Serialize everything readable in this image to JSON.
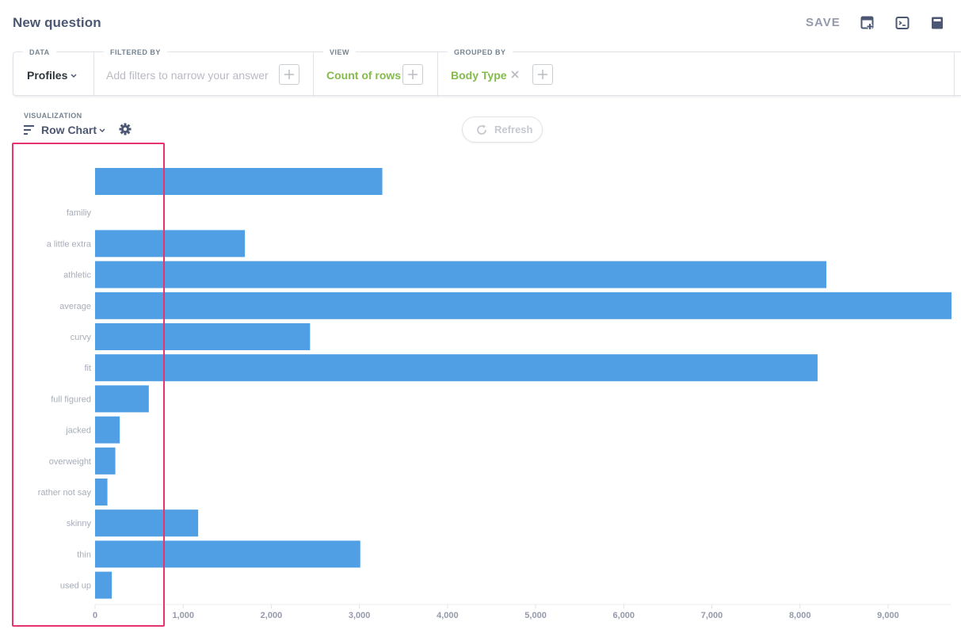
{
  "header": {
    "title": "New question",
    "save_label": "SAVE",
    "icons": [
      "add-to-dashboard-icon",
      "sql-editor-icon",
      "notebook-icon"
    ]
  },
  "query": {
    "data": {
      "label": "DATA",
      "value": "Profiles"
    },
    "filtered_by": {
      "label": "FILTERED BY",
      "placeholder": "Add filters to narrow your answer"
    },
    "view": {
      "label": "VIEW",
      "value": "Count of rows"
    },
    "grouped_by": {
      "label": "GROUPED BY",
      "value": "Body Type"
    }
  },
  "visualization": {
    "label": "VISUALIZATION",
    "type_label": "Row Chart",
    "refresh_label": "Refresh"
  },
  "colors": {
    "bar": "#509ee3",
    "accent_green": "#84bb4c",
    "highlight": "#e8336e"
  },
  "chart_data": {
    "type": "bar",
    "orientation": "horizontal",
    "categories": [
      "",
      "familiy",
      "a little extra",
      "athletic",
      "average",
      "curvy",
      "fit",
      "full figured",
      "jacked",
      "overweight",
      "rather not say",
      "skinny",
      "thin",
      "used up"
    ],
    "values": [
      3260,
      0,
      1700,
      8300,
      9720,
      2440,
      8200,
      610,
      280,
      230,
      140,
      1170,
      3010,
      190
    ],
    "x_ticks": [
      0,
      1000,
      2000,
      3000,
      4000,
      5000,
      6000,
      7000,
      8000,
      9000
    ],
    "x_tick_labels": [
      "0",
      "1,000",
      "2,000",
      "3,000",
      "4,000",
      "5,000",
      "6,000",
      "7,000",
      "8,000",
      "9,000"
    ],
    "xlim": [
      0,
      9720
    ],
    "grid": false,
    "legend": "none"
  }
}
